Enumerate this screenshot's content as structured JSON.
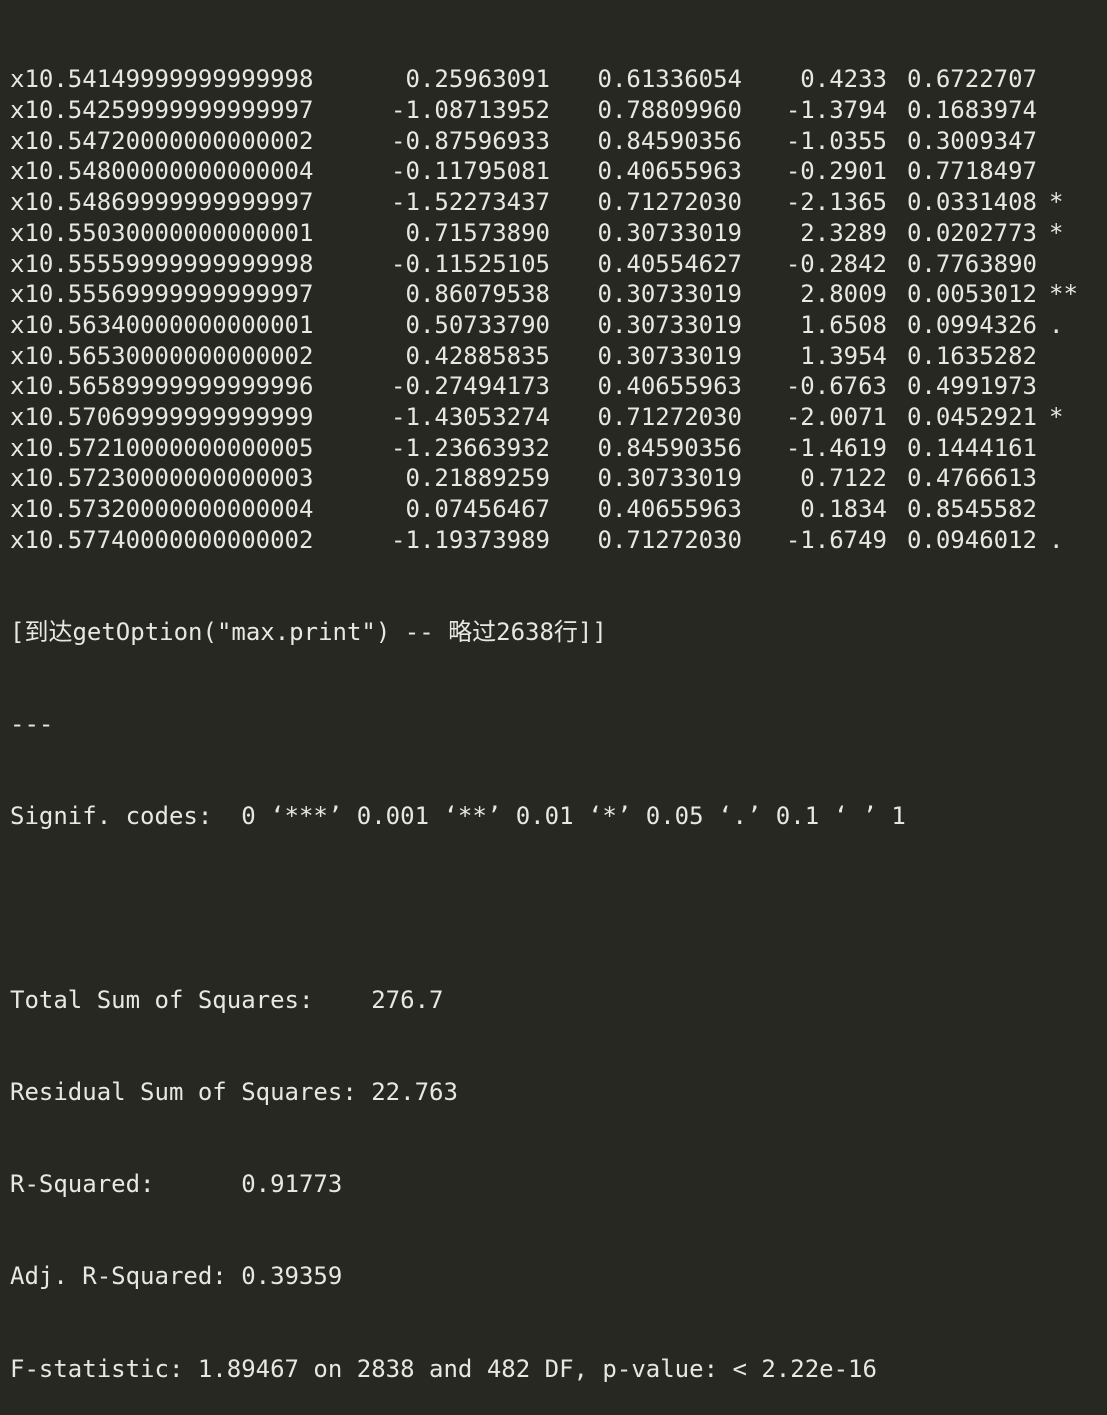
{
  "coefficients": [
    {
      "name": "x10.54149999999999998",
      "estimate": "0.25963091",
      "std_error": "0.61336054",
      "t_value": "0.4233",
      "p_value": "0.6722707",
      "signif": ""
    },
    {
      "name": "x10.54259999999999997",
      "estimate": "-1.08713952",
      "std_error": "0.78809960",
      "t_value": "-1.3794",
      "p_value": "0.1683974",
      "signif": ""
    },
    {
      "name": "x10.54720000000000002",
      "estimate": "-0.87596933",
      "std_error": "0.84590356",
      "t_value": "-1.0355",
      "p_value": "0.3009347",
      "signif": ""
    },
    {
      "name": "x10.54800000000000004",
      "estimate": "-0.11795081",
      "std_error": "0.40655963",
      "t_value": "-0.2901",
      "p_value": "0.7718497",
      "signif": ""
    },
    {
      "name": "x10.54869999999999997",
      "estimate": "-1.52273437",
      "std_error": "0.71272030",
      "t_value": "-2.1365",
      "p_value": "0.0331408",
      "signif": "*"
    },
    {
      "name": "x10.55030000000000001",
      "estimate": "0.71573890",
      "std_error": "0.30733019",
      "t_value": "2.3289",
      "p_value": "0.0202773",
      "signif": "*"
    },
    {
      "name": "x10.55559999999999998",
      "estimate": "-0.11525105",
      "std_error": "0.40554627",
      "t_value": "-0.2842",
      "p_value": "0.7763890",
      "signif": ""
    },
    {
      "name": "x10.55569999999999997",
      "estimate": "0.86079538",
      "std_error": "0.30733019",
      "t_value": "2.8009",
      "p_value": "0.0053012",
      "signif": "**"
    },
    {
      "name": "x10.56340000000000001",
      "estimate": "0.50733790",
      "std_error": "0.30733019",
      "t_value": "1.6508",
      "p_value": "0.0994326",
      "signif": "."
    },
    {
      "name": "x10.56530000000000002",
      "estimate": "0.42885835",
      "std_error": "0.30733019",
      "t_value": "1.3954",
      "p_value": "0.1635282",
      "signif": ""
    },
    {
      "name": "x10.56589999999999996",
      "estimate": "-0.27494173",
      "std_error": "0.40655963",
      "t_value": "-0.6763",
      "p_value": "0.4991973",
      "signif": ""
    },
    {
      "name": "x10.57069999999999999",
      "estimate": "-1.43053274",
      "std_error": "0.71272030",
      "t_value": "-2.0071",
      "p_value": "0.0452921",
      "signif": "*"
    },
    {
      "name": "x10.57210000000000005",
      "estimate": "-1.23663932",
      "std_error": "0.84590356",
      "t_value": "-1.4619",
      "p_value": "0.1444161",
      "signif": ""
    },
    {
      "name": "x10.57230000000000003",
      "estimate": "0.21889259",
      "std_error": "0.30733019",
      "t_value": "0.7122",
      "p_value": "0.4766613",
      "signif": ""
    },
    {
      "name": "x10.57320000000000004",
      "estimate": "0.07456467",
      "std_error": "0.40655963",
      "t_value": "0.1834",
      "p_value": "0.8545582",
      "signif": ""
    },
    {
      "name": "x10.57740000000000002",
      "estimate": "-1.19373989",
      "std_error": "0.71272030",
      "t_value": "-1.6749",
      "p_value": "0.0946012",
      "signif": "."
    }
  ],
  "truncation_notice": "[到达getOption(\"max.print\") -- 略过2638行]]",
  "separator": "---",
  "signif_codes": "Signif. codes:  0 ‘***’ 0.001 ‘**’ 0.01 ‘*’ 0.05 ‘.’ 0.1 ‘ ’ 1",
  "summary": {
    "total_ss": "Total Sum of Squares:    276.7",
    "residual_ss": "Residual Sum of Squares: 22.763",
    "r_squared": "R-Squared:      0.91773",
    "adj_r_squared": "Adj. R-Squared: 0.39359",
    "f_statistic": "F-statistic: 1.89467 on 2838 and 482 DF, p-value: < 2.22e-16"
  },
  "colors": {
    "background": "#272822",
    "text": "#e8e8e2"
  }
}
